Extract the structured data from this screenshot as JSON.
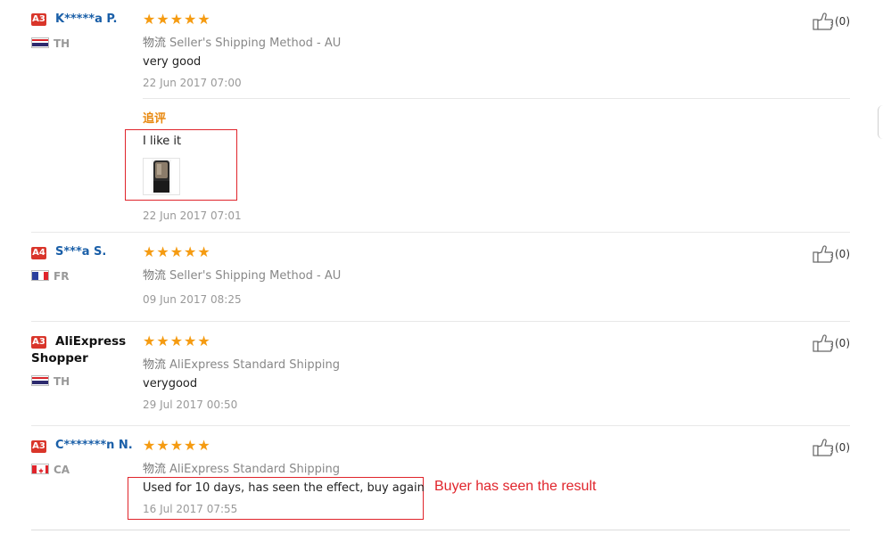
{
  "reviews": [
    {
      "badge": "A3",
      "name": "K*****a P.",
      "country": "TH",
      "flag": "thailand",
      "stars": 5,
      "shipping_cn": "物流",
      "shipping": "Seller's Shipping Method - AU",
      "text": "very good",
      "date": "22 Jun 2017 07:00",
      "likes": "(0)",
      "append_label": "追评",
      "append_text": "I like it",
      "append_date": "22 Jun 2017 07:01"
    },
    {
      "badge": "A4",
      "name": "S***a S.",
      "country": "FR",
      "flag": "france",
      "stars": 5,
      "shipping_cn": "物流",
      "shipping": "Seller's Shipping Method - AU",
      "text": "",
      "date": "09 Jun 2017 08:25",
      "likes": "(0)"
    },
    {
      "badge": "A3",
      "name": "AliExpress Shopper",
      "country": "TH",
      "flag": "thailand",
      "stars": 5,
      "shipping_cn": "物流",
      "shipping": "AliExpress Standard Shipping",
      "text": "verygood",
      "date": "29 Jul 2017 00:50",
      "likes": "(0)"
    },
    {
      "badge": "A3",
      "name": "C*******n N.",
      "country": "CA",
      "flag": "canada",
      "stars": 5,
      "shipping_cn": "物流",
      "shipping": "AliExpress Standard Shipping",
      "text": "Used for 10 days, has seen the effect, buy again",
      "date": "16 Jul 2017 07:55",
      "likes": "(0)"
    }
  ],
  "annotation": "Buyer has seen the result",
  "colors": {
    "badge": "#d9352a",
    "name": "#1a5fa8",
    "star": "#f59b11",
    "append_label": "#e8880f",
    "highlight_box": "#e0242b"
  },
  "icons": [
    "thumbs-up-icon",
    "star-icon",
    "thailand-flag-icon",
    "france-flag-icon",
    "canada-flag-icon"
  ]
}
